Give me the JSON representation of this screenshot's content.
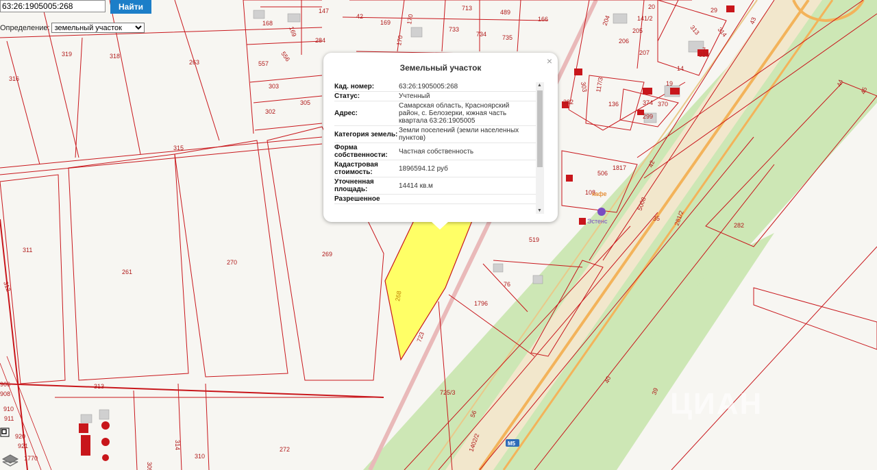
{
  "search": {
    "value": "63:26:1905005:268",
    "button_label": "Найти"
  },
  "definition": {
    "label": "Определение:",
    "selected": "земельный участок"
  },
  "popup": {
    "title": "Земельный участок",
    "close_glyph": "×",
    "rows": [
      {
        "key": "Кад. номер:",
        "value": "63:26:1905005:268"
      },
      {
        "key": "Статус:",
        "value": "Учтенный"
      },
      {
        "key": "Адрес:",
        "value": "Самарская область, Красноярский район, с. Белозерки, южная часть квартала 63:26:1905005"
      },
      {
        "key": "Категория земель:",
        "value": "Земли поселений (земли населенных пунктов)"
      },
      {
        "key": "Форма собственности:",
        "value": "Частная собственность"
      },
      {
        "key": "Кадастровая стоимость:",
        "value": "1896594.12 руб"
      },
      {
        "key": "Уточненная площадь:",
        "value": "14414 кв.м"
      },
      {
        "key": "Разрешенное",
        "value": ""
      }
    ]
  },
  "map": {
    "parcel_labels": [
      "168",
      "169",
      "147",
      "42",
      "169",
      "170",
      "713",
      "489",
      "166",
      "733",
      "734",
      "735",
      "284",
      "170",
      "319",
      "318",
      "263",
      "316",
      "557",
      "556",
      "303",
      "302",
      "305",
      "315",
      "311",
      "261",
      "270",
      "269",
      "268",
      "313",
      "312",
      "272",
      "310",
      "309",
      "314",
      "1770",
      "921",
      "920",
      "911",
      "910",
      "908",
      "906",
      "723",
      "725/3",
      "1796",
      "76",
      "519",
      "56",
      "1402/2",
      "282",
      "44",
      "45",
      "43",
      "40",
      "39",
      "35",
      "281/2",
      "5008",
      "42",
      "1817",
      "506",
      "108",
      "382",
      "136",
      "117/3",
      "303",
      "374",
      "370",
      "299",
      "19",
      "14",
      "7",
      "328",
      "313",
      "314",
      "29",
      "20",
      "141/2",
      "205",
      "206",
      "207",
      "204"
    ],
    "road_badge": "M5",
    "poi_label": "кафе",
    "poi_label2": "Эстенс"
  },
  "watermark": "ЦИАН",
  "colors": {
    "parcel_border": "#c8161b",
    "selected_fill": "#ffff66",
    "green_strip": "#cde7b5",
    "highway_orange": "#f3b35a",
    "button_blue": "#1c7ec8"
  },
  "icons": [
    "layers-icon",
    "zoom-box-icon",
    "close-icon"
  ]
}
